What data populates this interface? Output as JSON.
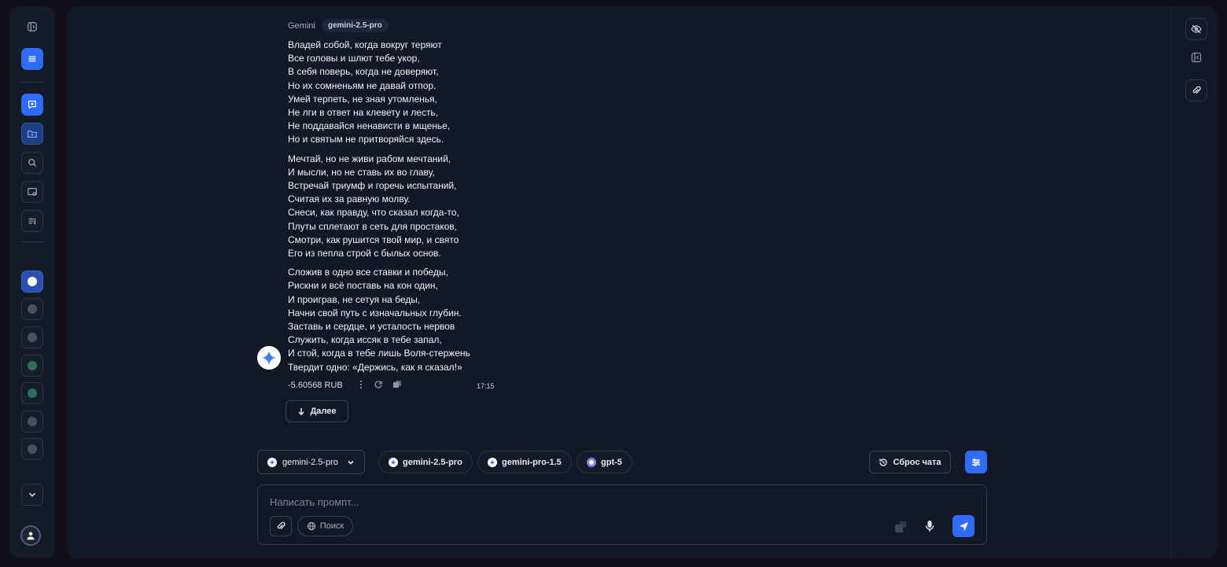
{
  "left_rail": {
    "icons": [
      "panel-toggle-icon",
      "menu-icon",
      "new-chat-icon",
      "new-folder-icon",
      "search-icon",
      "image-chat-icon",
      "prompts-icon"
    ],
    "models": [
      "gemini-icon",
      "model-icon",
      "model-icon",
      "openai-icon",
      "openai-icon",
      "model-icon",
      "model-icon"
    ]
  },
  "message": {
    "sender": "Gemini",
    "model": "gemini-2.5-pro",
    "stanzas": [
      [
        "Владей собой, когда вокруг теряют",
        "Все головы и шлют тебе укор,",
        "В себя поверь, когда не доверяют,",
        "Но их сомненьям не давай отпор.",
        "Умей терпеть, не зная утомленья,",
        "Не лги в ответ на клевету и лесть,",
        "Не поддавайся ненависти в мщенье,",
        "Но и святым не притворяйся здесь."
      ],
      [
        "Мечтай, но не живи рабом мечтаний,",
        "И мысли, но не ставь их во главу,",
        "Встречай триумф и горечь испытаний,",
        "Считая их за равную молву.",
        "Снеси, как правду, что сказал когда-то,",
        "Плуты сплетают в сеть для простаков,",
        "Смотри, как рушится твой мир, и свято",
        "Его из пепла строй с былых основ."
      ],
      [
        "Сложив в одно все ставки и победы,",
        "Рискни и всё поставь на кон один,",
        "И проиграв, не сетуя на беды,",
        "Начни свой путь с изначальных глубин.",
        "Заставь и сердце, и усталость нервов",
        "Служить, когда иссяк в тебе запал,",
        "И стой, когда в тебе лишь Воля-стержень",
        "Твердит одно: «Держись, как я сказал!»"
      ]
    ],
    "cost": "-5.60568 RUB",
    "time": "17:15"
  },
  "next_button": "Далее",
  "model_select": "gemini-2.5-pro",
  "chips": [
    {
      "label": "gemini-2.5-pro",
      "icon": "gemini-icon"
    },
    {
      "label": "gemini-pro-1.5",
      "icon": "gemini-icon"
    },
    {
      "label": "gpt-5",
      "icon": "openai-icon"
    }
  ],
  "reset_button": "Сброс чата",
  "composer": {
    "placeholder": "Написать промпт...",
    "search_label": "Поиск"
  },
  "colors": {
    "accent": "#2f6bff",
    "panel": "#111826",
    "background": "#120f18"
  }
}
